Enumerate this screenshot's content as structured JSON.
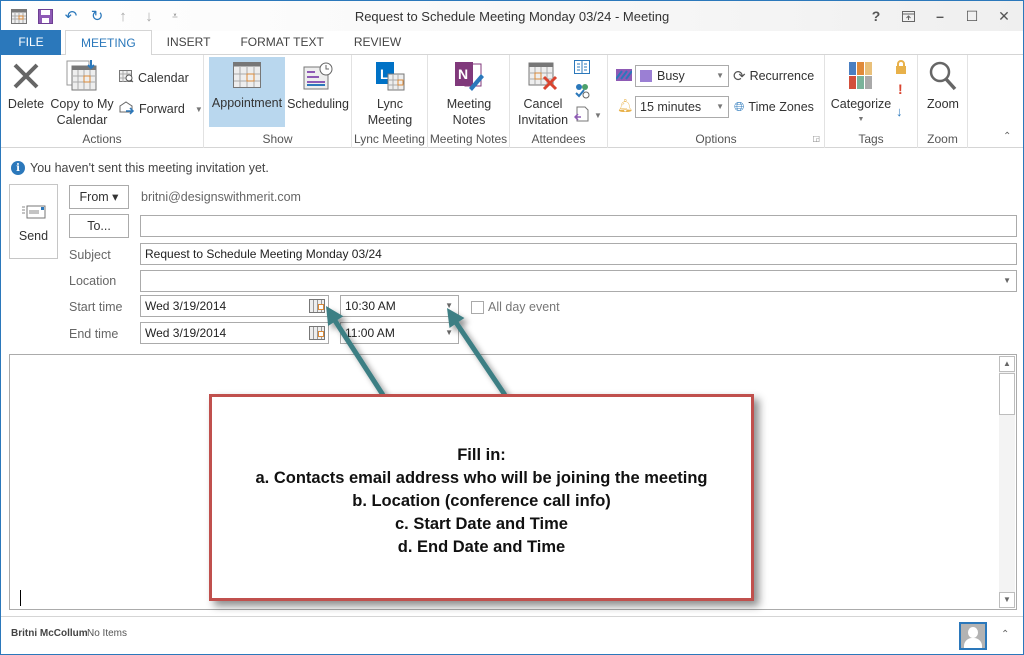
{
  "window": {
    "title": "Request to Schedule Meeting Monday 03/24 - Meeting",
    "controls": {
      "help": "?",
      "restore_ribbon": "⇱",
      "minimize": "–",
      "maximize": "☐",
      "close": "✕"
    }
  },
  "qat": {
    "icons": [
      "calendar-icon",
      "save-icon",
      "undo-icon",
      "redo-icon",
      "previous-item-icon",
      "next-item-icon",
      "customize-qat-icon"
    ]
  },
  "tabs": [
    "FILE",
    "MEETING",
    "INSERT",
    "FORMAT TEXT",
    "REVIEW"
  ],
  "active_tab": "MEETING",
  "ribbon": {
    "actions": {
      "label": "Actions",
      "delete": "Delete",
      "copy_to_calendar": [
        "Copy to My",
        "Calendar"
      ],
      "calendar": "Calendar",
      "forward": "Forward"
    },
    "show": {
      "label": "Show",
      "appointment": "Appointment",
      "scheduling": "Scheduling"
    },
    "lync": {
      "label": "Lync Meeting",
      "button": [
        "Lync",
        "Meeting"
      ]
    },
    "notes": {
      "label": "Meeting Notes",
      "button": [
        "Meeting",
        "Notes"
      ]
    },
    "attendees": {
      "label": "Attendees",
      "cancel": [
        "Cancel",
        "Invitation"
      ]
    },
    "options": {
      "label": "Options",
      "show_as": "Busy",
      "show_as_color": "#9b7fd4",
      "reminder": "15 minutes",
      "recurrence": "Recurrence",
      "time_zones": "Time Zones"
    },
    "tags": {
      "label": "Tags",
      "categorize": "Categorize"
    },
    "zoom": {
      "label": "Zoom",
      "button": "Zoom"
    }
  },
  "info_bar": "You haven't sent this meeting invitation yet.",
  "form": {
    "send": "Send",
    "from_button": "From ▾",
    "from_value": "britni@designswithmerit.com",
    "to_button": "To...",
    "to_value": "",
    "subject_label": "Subject",
    "subject_value": "Request to Schedule Meeting Monday 03/24",
    "location_label": "Location",
    "location_value": "",
    "start_label": "Start time",
    "start_date": "Wed 3/19/2014",
    "start_time": "10:30 AM",
    "all_day_label": "All day event",
    "all_day_checked": false,
    "end_label": "End time",
    "end_date": "Wed 3/19/2014",
    "end_time": "11:00 AM"
  },
  "annotation": {
    "title": "Fill in:",
    "lines": [
      "a. Contacts email address who will be joining the meeting",
      "b. Location (conference call info)",
      "c. Start Date and Time",
      "d. End Date and Time"
    ],
    "border_color": "#c0504d",
    "arrow_color": "#3d7f84"
  },
  "status": {
    "user": "Britni McCollum",
    "items": "No Items"
  }
}
